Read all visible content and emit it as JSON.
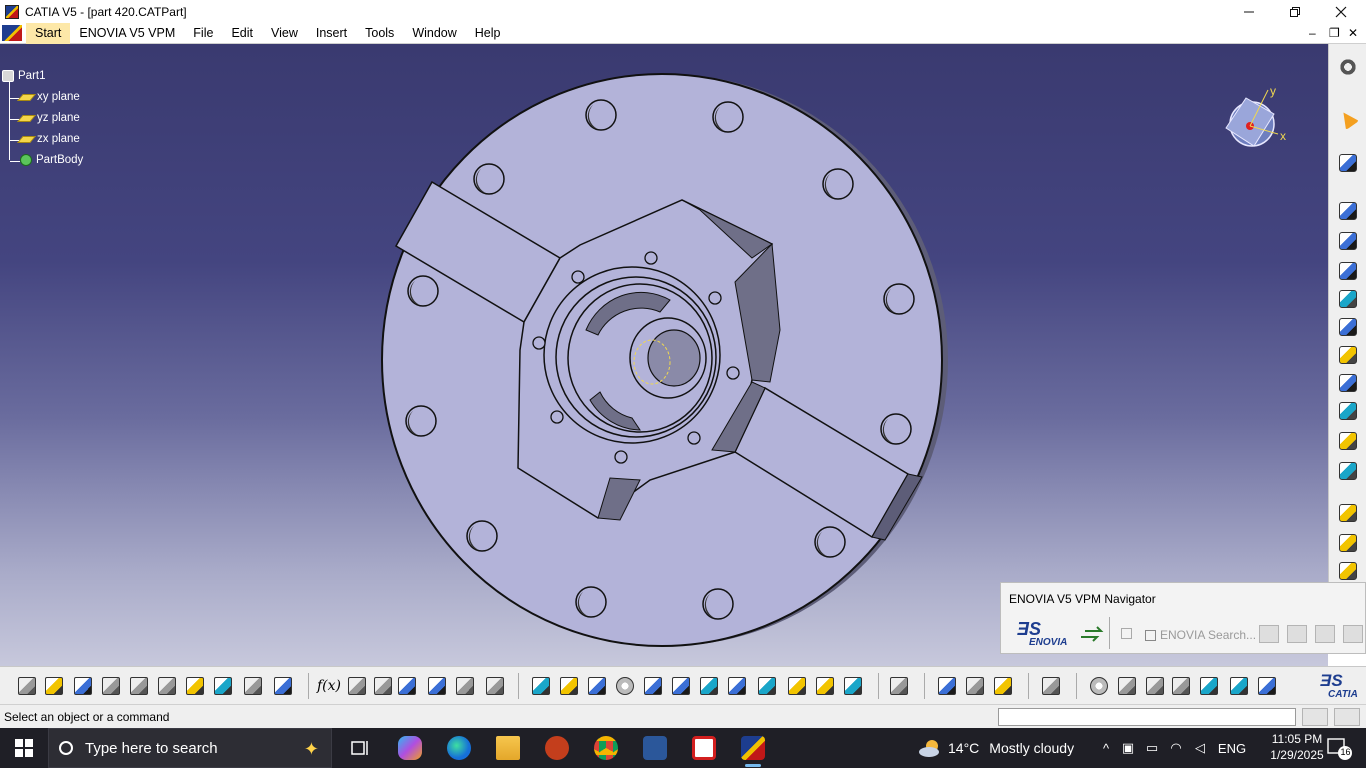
{
  "window": {
    "title": "CATIA V5 - [part 420.CATPart]",
    "controls": [
      "minimize",
      "restore",
      "close"
    ]
  },
  "menu": {
    "items": [
      "Start",
      "ENOVIA V5 VPM",
      "File",
      "Edit",
      "View",
      "Insert",
      "Tools",
      "Window",
      "Help"
    ],
    "active": "Start"
  },
  "tree": {
    "root": "Part1",
    "children": [
      "xy plane",
      "yz plane",
      "zx plane",
      "PartBody"
    ]
  },
  "compass": {
    "x_label": "x",
    "y_label": "y"
  },
  "enovia": {
    "title": "ENOVIA V5 VPM Navigator",
    "logo_text": "ENOVIA",
    "search_placeholder": "ENOVIA Search..."
  },
  "catia_logo_text": "CATIA",
  "statusbar": {
    "message": "Select an object or a command"
  },
  "taskbar": {
    "search_placeholder": "Type here to search",
    "weather": {
      "temp": "14°C",
      "condition": "Mostly cloudy"
    },
    "language": "ENG",
    "time": "11:05 PM",
    "date": "1/29/2025",
    "notification_count": "16",
    "apps": [
      "task-view",
      "copilot",
      "edge",
      "file-explorer",
      "power-app",
      "chrome",
      "word",
      "pdf-reader",
      "catia"
    ]
  },
  "colors": {
    "viewport_top": "#3a3a70",
    "viewport_bottom": "#c7c8dc",
    "part_fill": "#b3b3d9",
    "part_shade": "#6f6f88",
    "accent_yellow": "#f0d850"
  }
}
